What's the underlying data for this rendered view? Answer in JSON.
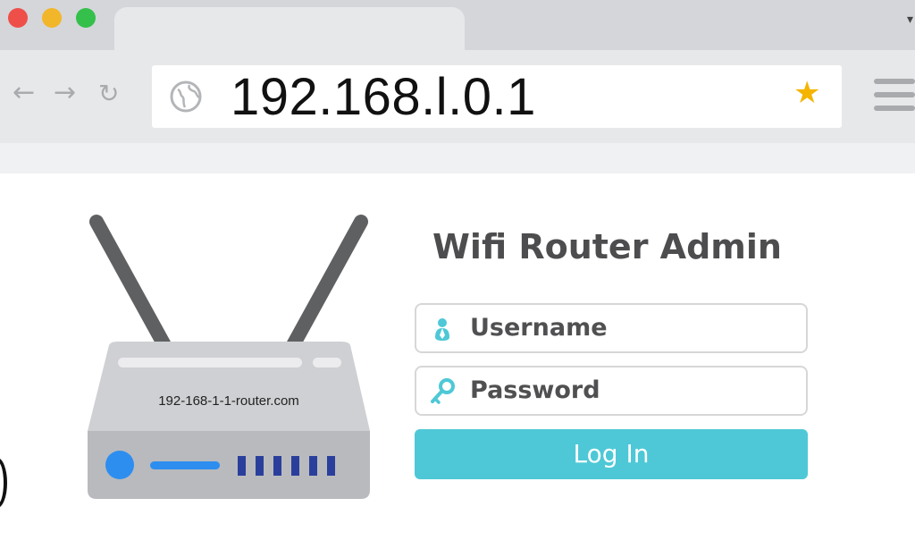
{
  "browser": {
    "address_bar": {
      "url": "192.168.l.0.1"
    },
    "icons": {
      "back": "arrow-left-icon",
      "forward": "arrow-right-icon",
      "reload": "reload-icon",
      "site": "globe-icon",
      "bookmark": "star-icon",
      "menu": "hamburger-menu-icon"
    },
    "colors": {
      "close": "#ee4f49",
      "minimize": "#f2b62a",
      "maximize": "#34c04a",
      "bookmark_star": "#f4b400"
    }
  },
  "router_illustration": {
    "label": "192-168-1-1-router.com"
  },
  "login": {
    "title": "Wifi Router Admin",
    "username_placeholder": "Username",
    "password_placeholder": "Password",
    "submit_label": "Log In",
    "accent_color": "#4ec8d6"
  }
}
